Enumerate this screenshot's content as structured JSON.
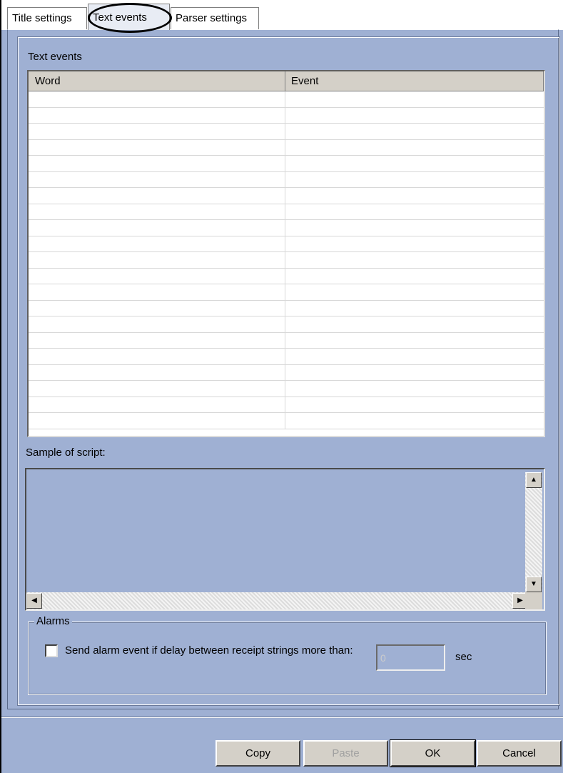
{
  "tabs": [
    {
      "label": "Title settings"
    },
    {
      "label": "Text events"
    },
    {
      "label": "Parser settings"
    }
  ],
  "text_events": {
    "label": "Text events",
    "columns": [
      "Word",
      "Event"
    ],
    "rows": []
  },
  "sample": {
    "label": "Sample of script:"
  },
  "alarms": {
    "legend": "Alarms",
    "checkbox_label": "Send alarm event if delay between receipt strings more than:",
    "checked": false,
    "delay_value": "0",
    "unit": "sec"
  },
  "buttons": {
    "copy": "Copy",
    "paste": "Paste",
    "ok": "OK",
    "cancel": "Cancel"
  }
}
